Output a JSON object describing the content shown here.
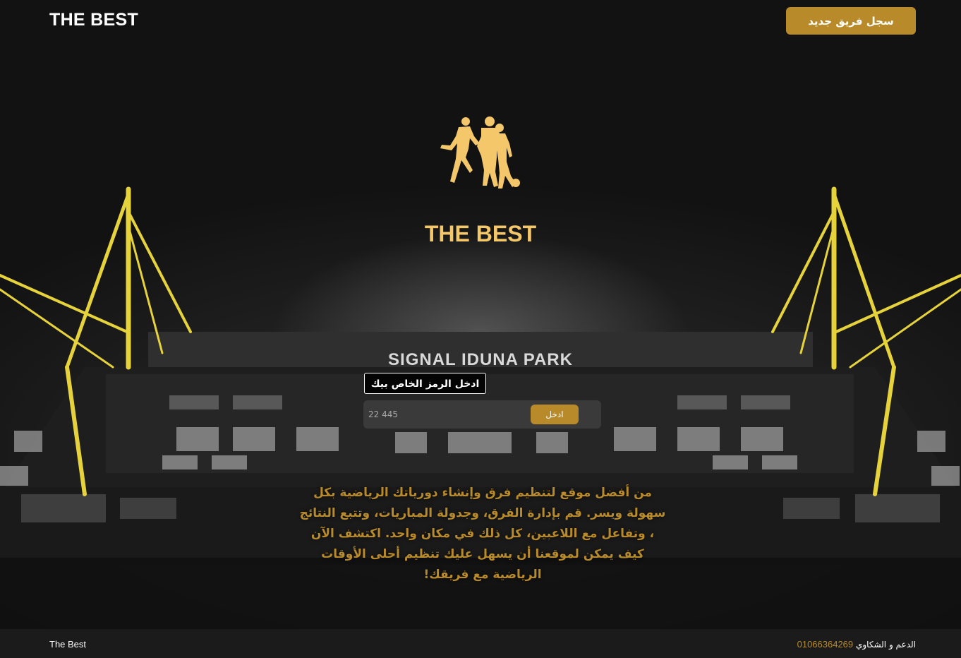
{
  "header": {
    "logo": "THE BEST",
    "register_button": "سجل فريق جديد"
  },
  "background": {
    "stadium_sign": "SIGNAL IDUNA PARK"
  },
  "hero": {
    "title": "THE BEST",
    "code_label": "ادخل الرمز الخاص بيك",
    "code_input_placeholder": "22 445",
    "enter_button": "ادخل",
    "description": "من أفضل موقع لتنظيم فرق وإنشاء دورياتك الرياضية بكل سهولة ويسر. قم بإدارة الفرق، وجدولة المباريات، وتتبع النتائج ، وتفاعل مع اللاعبين، كل ذلك في مكان واحد. اكتشف الآن كيف يمكن لموقعنا أن يسهل عليك تنظيم أحلى الأوقات الرياضية مع فريقك!"
  },
  "footer": {
    "brand": "The Best",
    "support_label": "الدعم و الشكاوي",
    "support_phone": "01066364269"
  },
  "colors": {
    "accent": "#b88a2a",
    "title_gold": "#f3c76a",
    "pylon_yellow": "#e6d23a",
    "footer_bg": "#1b1b1b"
  },
  "icons": {
    "hero_icon": "football-players-icon"
  }
}
